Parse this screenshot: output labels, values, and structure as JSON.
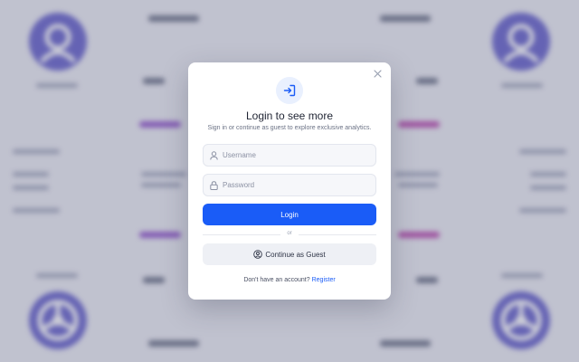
{
  "modal": {
    "title": "Login to see more",
    "subtitle": "Sign in or continue as guest to explore exclusive analytics.",
    "close_icon": "close-icon",
    "header_icon": "login-arrow-icon",
    "username": {
      "placeholder": "Username",
      "value": "",
      "icon": "user-icon"
    },
    "password": {
      "placeholder": "Password",
      "value": "",
      "icon": "lock-icon"
    },
    "login_label": "Login",
    "divider_label": "or",
    "guest_label": "Continue as Guest",
    "guest_icon": "user-circle-icon",
    "footer_text": "Don't have an account?",
    "register_label": "Register"
  },
  "colors": {
    "accent": "#1a5cf7",
    "background_avatar": "#5a55c8",
    "background_bar": "#8a47c7"
  }
}
